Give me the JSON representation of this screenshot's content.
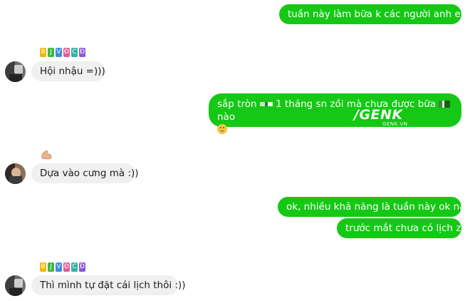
{
  "conversation": {
    "messages": [
      {
        "direction": "outgoing",
        "text": "tuần này làm bữa k các người anh em"
      },
      {
        "direction": "incoming",
        "text": "Hội nhậu =)))"
      },
      {
        "direction": "outgoing",
        "text_before": "sắp tròn",
        "text_mid": "1 tháng sn zồi mà chưa được bữa",
        "text_after": "nào"
      },
      {
        "direction": "incoming",
        "text": "Dựa vào cưng mà :))"
      },
      {
        "direction": "outgoing",
        "text": "ok, nhiều khả năng là tuần này ok này"
      },
      {
        "direction": "outgoing",
        "text": "trước mắt chưa có lịch zì"
      },
      {
        "direction": "incoming",
        "text": "Thì mình tự đặt cái lịch thôi :))"
      }
    ],
    "sender_tag_letters": [
      "B",
      "J",
      "V",
      "Đ",
      "C",
      "Đ"
    ],
    "icons": {
      "sad_emoji": "worried-face-icon",
      "reaction": "flexed-biceps-icon"
    }
  },
  "watermark": {
    "brand": "/GENK",
    "site": "GENK.VN"
  },
  "colors": {
    "outgoing_bubble": "#15c815",
    "incoming_bubble": "#f0f0f0"
  }
}
